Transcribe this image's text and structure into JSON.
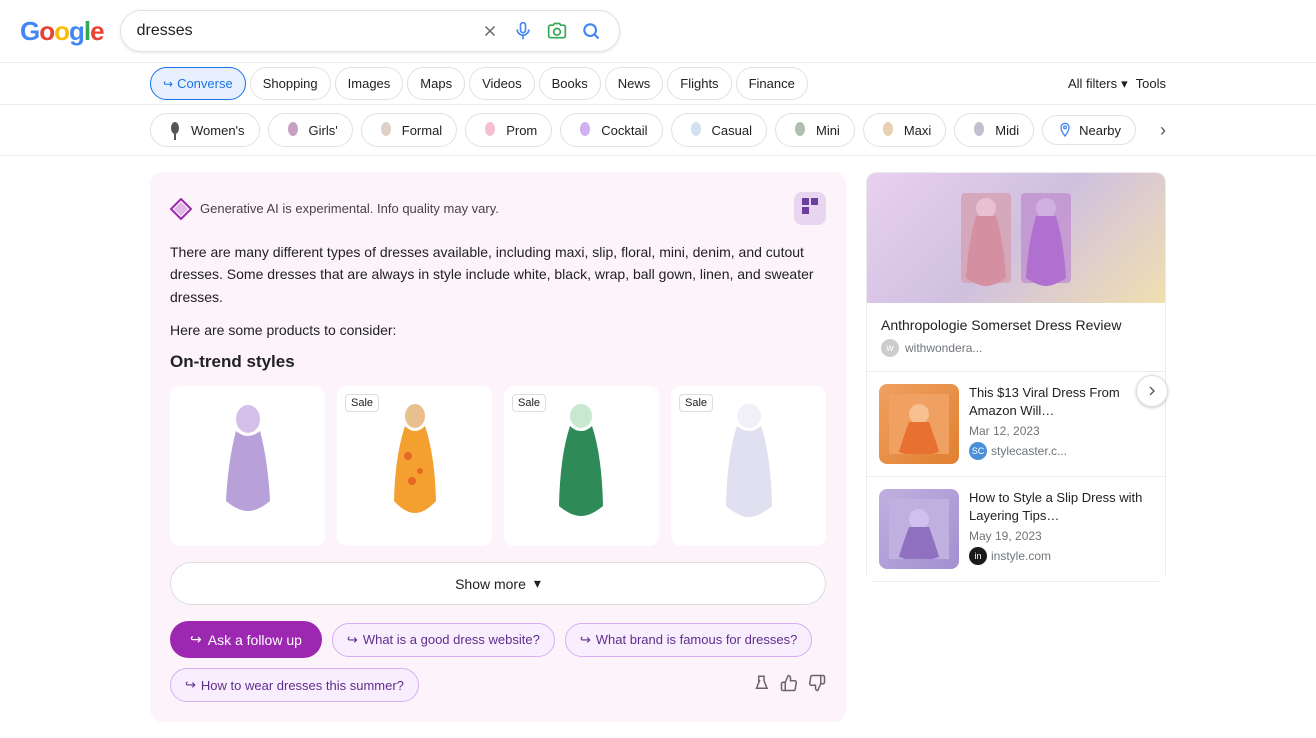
{
  "logo": {
    "text": "Google",
    "parts": [
      "G",
      "o",
      "o",
      "g",
      "l",
      "e"
    ]
  },
  "search": {
    "value": "dresses",
    "placeholder": "Search"
  },
  "nav_tabs": [
    {
      "label": "Converse",
      "active": true,
      "icon": "↪"
    },
    {
      "label": "Shopping",
      "active": false
    },
    {
      "label": "Images",
      "active": false
    },
    {
      "label": "Maps",
      "active": false
    },
    {
      "label": "Videos",
      "active": false
    },
    {
      "label": "Books",
      "active": false
    },
    {
      "label": "News",
      "active": false
    },
    {
      "label": "Flights",
      "active": false
    },
    {
      "label": "Finance",
      "active": false
    }
  ],
  "nav_right": {
    "all_filters": "All filters",
    "tools": "Tools"
  },
  "filter_chips": [
    {
      "label": "Women's",
      "has_img": true
    },
    {
      "label": "Girls'",
      "has_img": true
    },
    {
      "label": "Formal",
      "has_img": true
    },
    {
      "label": "Prom",
      "has_img": true
    },
    {
      "label": "Cocktail",
      "has_img": true
    },
    {
      "label": "Casual",
      "has_img": true
    },
    {
      "label": "Mini",
      "has_img": true
    },
    {
      "label": "Maxi",
      "has_img": true
    },
    {
      "label": "Midi",
      "has_img": true
    },
    {
      "label": "Nearby",
      "has_img": false,
      "is_location": true
    }
  ],
  "ai": {
    "notice": "Generative AI is experimental. Info quality may vary.",
    "description": "There are many different types of dresses available, including maxi, slip, floral, mini, denim, and cutout dresses. Some dresses that are always in style include white, black, wrap, ball gown, linen, and sweater dresses.",
    "products_intro": "Here are some products to consider:",
    "section_title": "On-trend styles",
    "products": [
      {
        "id": 1,
        "sale": false,
        "color": "#c8b4e0"
      },
      {
        "id": 2,
        "sale": true,
        "color": "#f4a460"
      },
      {
        "id": 3,
        "sale": true,
        "color": "#2e8b57"
      },
      {
        "id": 4,
        "sale": true,
        "color": "#e8e8f0"
      }
    ],
    "show_more": "Show more",
    "follow_up_btn": "Ask a follow up",
    "suggestions": [
      "What is a good dress website?",
      "What brand is famous for dresses?",
      "How to wear dresses this summer?"
    ]
  },
  "right_panel": {
    "main_article": {
      "title": "Anthropologie Somerset Dress Review",
      "source": "withwondera...",
      "avatar_text": "w"
    },
    "articles": [
      {
        "title": "This $13 Viral Dress From Amazon Will…",
        "date": "Mar 12, 2023",
        "source": "stylecaster.c...",
        "source_prefix": "SC"
      },
      {
        "title": "How to Style a Slip Dress with Layering Tips…",
        "date": "May 19, 2023",
        "source": "instyle.com",
        "source_prefix": "in"
      }
    ]
  }
}
